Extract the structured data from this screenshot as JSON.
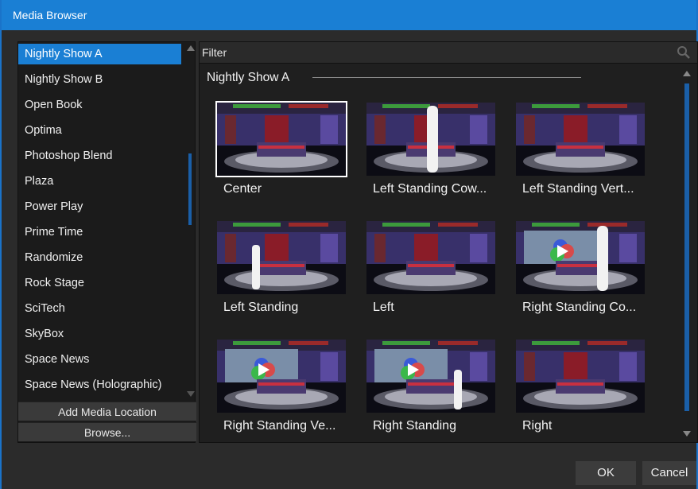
{
  "window": {
    "title": "Media Browser"
  },
  "sidebar": {
    "items": [
      {
        "label": "Nightly Show A",
        "selected": true
      },
      {
        "label": "Nightly Show B"
      },
      {
        "label": "Open Book"
      },
      {
        "label": "Optima"
      },
      {
        "label": "Photoshop Blend"
      },
      {
        "label": "Plaza"
      },
      {
        "label": "Power Play"
      },
      {
        "label": "Prime Time"
      },
      {
        "label": "Randomize"
      },
      {
        "label": "Rock Stage"
      },
      {
        "label": "SciTech"
      },
      {
        "label": "SkyBox"
      },
      {
        "label": "Space News"
      },
      {
        "label": "Space News (Holographic)"
      }
    ],
    "add_media_location_label": "Add Media Location",
    "browse_label": "Browse..."
  },
  "main": {
    "filter_label": "Filter",
    "search_icon": "search-icon",
    "group_title": "Nightly Show A",
    "tiles": [
      {
        "label": "Center",
        "selected": true,
        "figure": "none",
        "screen": false
      },
      {
        "label": "Left Standing Cow...",
        "figure": "left-big",
        "screen": false
      },
      {
        "label": "Left Standing Vert...",
        "figure": "none",
        "screen": false
      },
      {
        "label": "Left Standing",
        "figure": "left",
        "screen": false
      },
      {
        "label": "Left",
        "figure": "none",
        "screen": false
      },
      {
        "label": "Right Standing Co...",
        "figure": "right-big",
        "screen": true
      },
      {
        "label": "Right Standing Ve...",
        "figure": "none",
        "screen": true
      },
      {
        "label": "Right Standing",
        "figure": "right",
        "screen": true
      },
      {
        "label": "Right",
        "figure": "none",
        "screen": false
      }
    ]
  },
  "footer": {
    "ok_label": "OK",
    "cancel_label": "Cancel"
  },
  "colors": {
    "accent": "#1a7fd4",
    "background": "#2b2b2b",
    "panel": "#1b1b1b"
  }
}
